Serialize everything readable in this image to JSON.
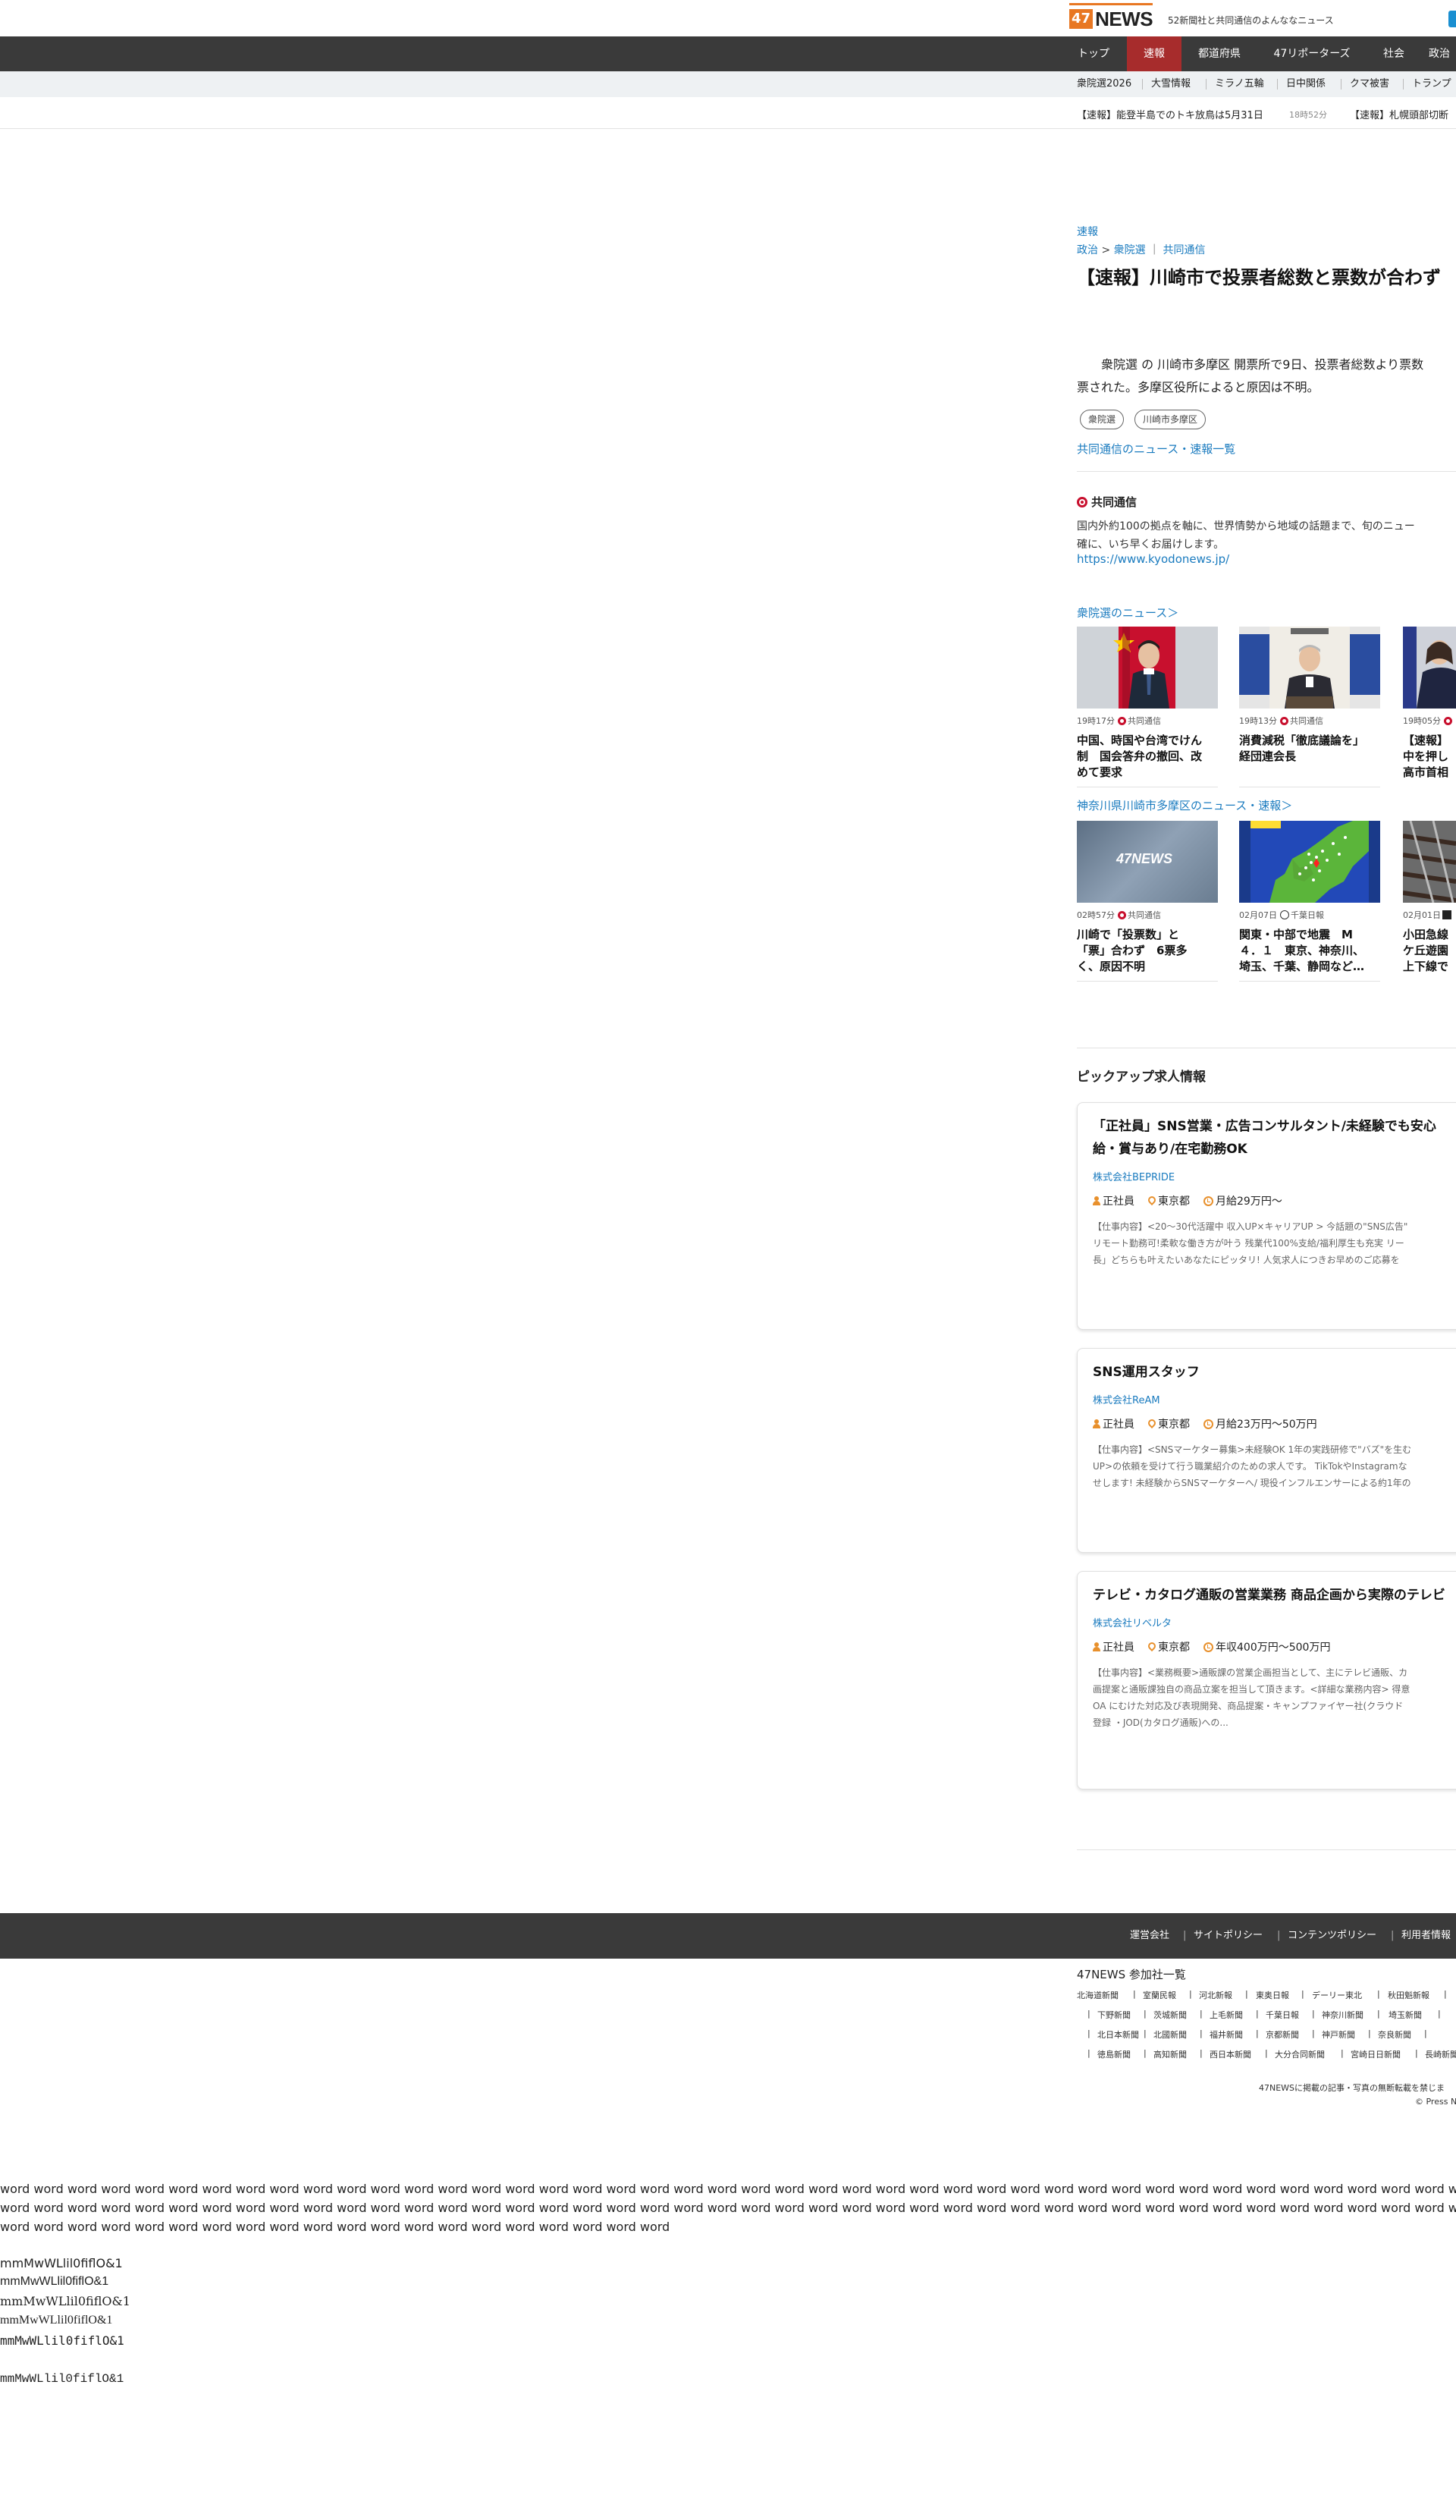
{
  "header": {
    "logo_number": "47",
    "logo_text": "NEWS",
    "tagline": "52新聞社と共同通信のよんななニュース"
  },
  "nav": {
    "items": [
      "トップ",
      "速報",
      "都道府県",
      "47リポーターズ",
      "社会",
      "政治"
    ],
    "active": "速報"
  },
  "subnav": {
    "items": [
      "衆院選2026",
      "大雪情報",
      "ミラノ五輪",
      "日中関係",
      "クマ被害",
      "トランプ"
    ]
  },
  "ticker": {
    "items": [
      {
        "text": "【速報】能登半島でのトキ放鳥は5月31日",
        "time": "18時52分"
      },
      {
        "text": "【速報】札幌頭部切断"
      }
    ]
  },
  "article": {
    "kind": "速報",
    "breadcrumb": {
      "category": "政治",
      "sub": "衆院選",
      "source": "共同通信"
    },
    "headline": "【速報】川崎市で投票者総数と票数が合わず",
    "body_lines": [
      "衆院選 の 川崎市多摩区 開票所で9日、投票者総数より票数",
      "票された。多摩区役所によると原因は不明。"
    ],
    "tags": [
      "衆院選",
      "川崎市多摩区"
    ],
    "more_link": "共同通信のニュース・速報一覧"
  },
  "provider": {
    "name": "共同通信",
    "desc_lines": [
      "国内外約100の拠点を軸に、世界情勢から地域の話題まで、旬のニュー",
      "確に、いち早くお届けします。"
    ],
    "url": "https://www.kyodonews.jp/"
  },
  "section1": {
    "title": "衆院選のニュース＞",
    "cards": [
      {
        "time": "19時17分",
        "source": "共同通信",
        "lines": [
          "中国、時国や台湾でけん",
          "制　国会答弁の撤回、改",
          "めて要求"
        ]
      },
      {
        "time": "19時13分",
        "source": "共同通信",
        "lines": [
          "消費減税「徹底議論を」",
          "経団連会長"
        ]
      },
      {
        "time": "19時05分",
        "source": "",
        "lines": [
          "【速報】",
          "中を押し",
          "高市首相"
        ]
      }
    ]
  },
  "section2": {
    "title": "神奈川県川崎市多摩区のニュース・速報＞",
    "cards": [
      {
        "time": "02時57分",
        "source": "共同通信",
        "thumb_logo": "47NEWS",
        "lines": [
          "川崎で「投票数」と",
          "「票」合わず　6票多",
          "く、原因不明"
        ]
      },
      {
        "time": "02月07日",
        "source": "千葉日報",
        "lines": [
          "関東・中部で地震　M",
          "４．１　東京、神奈川、",
          "埼玉、千葉、静岡など…"
        ]
      },
      {
        "time": "02月01日",
        "source": "",
        "lines": [
          "小田急線",
          "ケ丘遊園",
          "上下線で"
        ]
      }
    ]
  },
  "pickup": {
    "title": "ピックアップ求人情報",
    "jobs": [
      {
        "title_lines": [
          "「正社員」SNS営業・広告コンサルタント/未経験でも安心",
          "給・賞与あり/在宅勤務OK"
        ],
        "company": "株式会社BEPRIDE",
        "type": "正社員",
        "location": "東京都",
        "salary": "月給29万円〜",
        "desc_lines": [
          "【仕事内容】<20〜30代活躍中 収入UP×キャリアUP > 今話題の\"SNS広告\"",
          "リモート勤務可!柔軟な働き方が叶う 残業代100%支給/福利厚生も充実 リー",
          "長」どちらも叶えたいあなたにピッタリ! 人気求人につきお早めのご応募を"
        ]
      },
      {
        "title_lines": [
          "SNS運用スタッフ"
        ],
        "company": "株式会社ReAM",
        "type": "正社員",
        "location": "東京都",
        "salary": "月給23万円〜50万円",
        "desc_lines": [
          "【仕事内容】<SNSマーケター募集>未経験OK 1年の実践研修で\"バズ\"を生む",
          "UP>の依頼を受けて行う職業紹介のための求人です。 TikTokやInstagramな",
          "せします! 未経験からSNSマーケターへ/ 現役インフルエンサーによる約1年の"
        ]
      },
      {
        "title_lines": [
          "テレビ・カタログ通販の営業業務 商品企画から実際のテレビ"
        ],
        "company": "株式会社リベルタ",
        "type": "正社員",
        "location": "東京都",
        "salary": "年収400万円〜500万円",
        "desc_lines": [
          "【仕事内容】<業務概要>通販課の営業企画担当として、主にテレビ通販、カ",
          "画提案と通販課独自の商品立案を担当して頂きます。<詳細な業務内容> 得意",
          "OA にむけた対応及び表現開発、商品提案・キャンプファイヤー社(クラウド",
          "登録 ・JOD(カタログ通販)への..."
        ]
      }
    ]
  },
  "footer": {
    "links": [
      "運営会社",
      "サイトポリシー",
      "コンテンツポリシー",
      "利用者情報"
    ],
    "members_title": "47NEWS 参加社一覧",
    "member_rows": [
      [
        "北海道新聞",
        "室蘭民報",
        "河北新報",
        "東奥日報",
        "デーリー東北",
        "秋田魁新報"
      ],
      [
        "下野新聞",
        "茨城新聞",
        "上毛新聞",
        "千葉日報",
        "神奈川新聞",
        "埼玉新聞"
      ],
      [
        "北日本新聞",
        "北國新聞",
        "福井新聞",
        "京都新聞",
        "神戸新聞",
        "奈良新聞"
      ],
      [
        "徳島新聞",
        "高知新聞",
        "西日本新聞",
        "大分合同新聞",
        "宮崎日日新聞",
        "長崎新聞"
      ]
    ],
    "copy_line1": "47NEWSに掲載の記事・写真の無断転載を禁じま",
    "copy_line2": "© Press N"
  },
  "test_text": {
    "word_lines": [
      "word word word word word word word word word word word word word word word word word word word word word word word word word word word word word word word word word word word word word word word word word word word word word word word word word",
      "word word word word word word word word word word word word word word word word word word word word word word word word word word word word word word word word word word word word word word word word word word word word word word word word word",
      "word word word word word word word word word word word word word word word word word word word word"
    ],
    "font_lines": [
      "mmMwWLlil0fiflO&1",
      "mmMwWLlil0fiflO&1",
      "mmMwWLlil0fiflO&1",
      "mmMwWLlil0fiflO&1",
      "mmMwWLlil0fiflO&1",
      "mmMwWLlil0fiflO&1"
    ]
  },
  "colors": {
    "nav_bg": "#3a3a3a",
    "nav_active": "#a72c2c",
    "link": "#1a7bbf",
    "brand_orange": "#e87722",
    "kyodo_red": "#c8102e"
  }
}
